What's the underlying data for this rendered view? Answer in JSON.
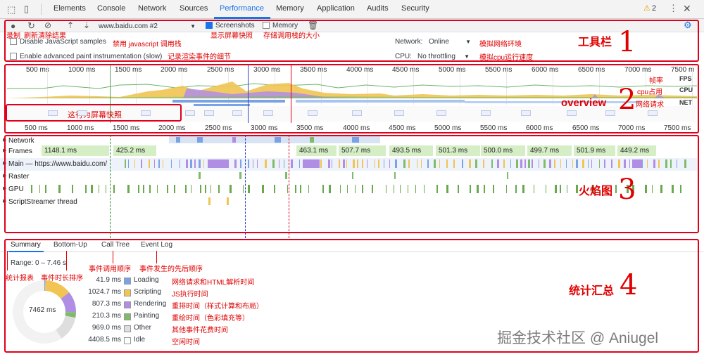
{
  "tabs": [
    "Elements",
    "Console",
    "Network",
    "Sources",
    "Performance",
    "Memory",
    "Application",
    "Audits",
    "Security"
  ],
  "active_tab": "Performance",
  "warning_count": "2",
  "toolbar": {
    "url_select": "www.baidu.com #2",
    "screenshots_label": "Screenshots",
    "memory_label": "Memory",
    "disable_js_label": "Disable JavaScript samples",
    "advanced_paint_label": "Enable advanced paint instrumentation (slow)",
    "network_label": "Network:",
    "network_value": "Online",
    "cpu_label": "CPU:",
    "cpu_value": "No throttling",
    "screenshots_checked": true,
    "memory_checked": false
  },
  "annotations": {
    "record": "录制",
    "refresh_clear": "刷新清除结果",
    "disable_js": "禁用 javascript 调用栈",
    "show_screenshots": "显示屏幕快照",
    "stack_size": "存储调用栈的大小",
    "paint_detail": "记录渲染事件的细节",
    "simulate_network": "模拟网络环境",
    "simulate_cpu": "模拟cpu运行速度",
    "toolbar_title": "工具栏",
    "toolbar_num": "1",
    "fps_note": "帧率",
    "cpu_note": "cpu占用",
    "net_note": "网络请求",
    "screenshot_row": "这行为屏幕快照",
    "overview_title": "overview",
    "overview_num": "2",
    "flame_title": "火焰图",
    "flame_num": "3",
    "summary_report": "统计报表",
    "bottom_up_note": "事件时长排序",
    "call_tree_note": "事件调用顺序",
    "event_log_note": "事件发生的先后顺序",
    "stats_title": "统计汇总",
    "stats_num": "4",
    "watermark": "掘金技术社区 @ Aniugel"
  },
  "overview": {
    "fps": "FPS",
    "cpu": "CPU",
    "net": "NET",
    "ticks": [
      "500 ms",
      "1000 ms",
      "1500 ms",
      "2000 ms",
      "2500 ms",
      "3000 ms",
      "3500 ms",
      "4000 ms",
      "4500 ms",
      "5000 ms",
      "5500 ms",
      "6000 ms",
      "6500 ms",
      "7000 ms",
      "7500 m"
    ],
    "ticks_bottom": [
      "500 ms",
      "1000 ms",
      "1500 ms",
      "2000 ms",
      "2500 ms",
      "3000 ms",
      "3500 ms",
      "4000 ms",
      "4500 ms",
      "5000 ms",
      "5500 ms",
      "6000 ms",
      "6500 ms",
      "7000 ms",
      "7500 ms"
    ]
  },
  "tracks": {
    "network": "Network",
    "frames": "Frames",
    "main": "Main — https://www.baidu.com/",
    "raster": "Raster",
    "gpu": "GPU",
    "script_streamer": "ScriptStreamer thread"
  },
  "frames": [
    {
      "label": "1148.1 ms"
    },
    {
      "label": "425.2 ms"
    },
    {
      "label": "463.1 ms"
    },
    {
      "label": "507.7 ms"
    },
    {
      "label": "493.5 ms"
    },
    {
      "label": "501.3 ms"
    },
    {
      "label": "500.0 ms"
    },
    {
      "label": "499.7 ms"
    },
    {
      "label": "501.9 ms"
    },
    {
      "label": "449.2 ms"
    }
  ],
  "summary": {
    "tabs": [
      "Summary",
      "Bottom-Up",
      "Call Tree",
      "Event Log"
    ],
    "range": "Range: 0 – 7.46 s",
    "total": "7462 ms",
    "rows": [
      {
        "value": "41.9 ms",
        "name": "Loading",
        "color": "#7aa3e5",
        "desc": "网络请求和HTML解析时间"
      },
      {
        "value": "1024.7 ms",
        "name": "Scripting",
        "color": "#f1c453",
        "desc": "JS执行时间"
      },
      {
        "value": "807.3 ms",
        "name": "Rendering",
        "color": "#af8ee3",
        "desc": "重排时间（样式计算和布局）"
      },
      {
        "value": "210.3 ms",
        "name": "Painting",
        "color": "#7fbb6b",
        "desc": "重绘时间（色彩填充等）"
      },
      {
        "value": "969.0 ms",
        "name": "Other",
        "color": "#dedede",
        "desc": "其他事件花费时间"
      },
      {
        "value": "4408.5 ms",
        "name": "Idle",
        "color": "#ffffff",
        "desc": "空闲时间"
      }
    ]
  },
  "colors": {
    "accent": "#1a73e8",
    "annotation": "#e0001b"
  }
}
